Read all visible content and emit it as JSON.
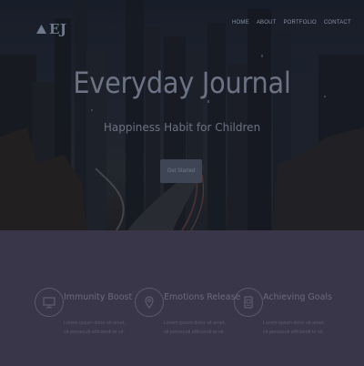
{
  "brand": {
    "logo_text": "EJ"
  },
  "nav": {
    "items": [
      "HOME",
      "ABOUT",
      "PORTFOLIO",
      "CONTACT"
    ]
  },
  "hero": {
    "title": "Everyday Journal",
    "subtitle": "Happiness Habit for Children",
    "cta_label": "Get Started"
  },
  "features": [
    {
      "icon": "monitor-icon",
      "title": "Immunity Boost",
      "desc": "Lorem ipsum dolor sit amet, sit persecuti efficiendi te sit."
    },
    {
      "icon": "location-pin-icon",
      "title": "Emotions Release",
      "desc": "Lorem ipsum dolor sit amet, sit persecuti efficiendi te sit."
    },
    {
      "icon": "tablet-icon",
      "title": "Achieving Goals",
      "desc": "Lorem ipsum dolor sit amet, sit persecuti efficiendi te sit."
    }
  ],
  "colors": {
    "page_bg": "#39364a",
    "hero_text": "#6c7384",
    "cta_bg": "#3e4655"
  }
}
